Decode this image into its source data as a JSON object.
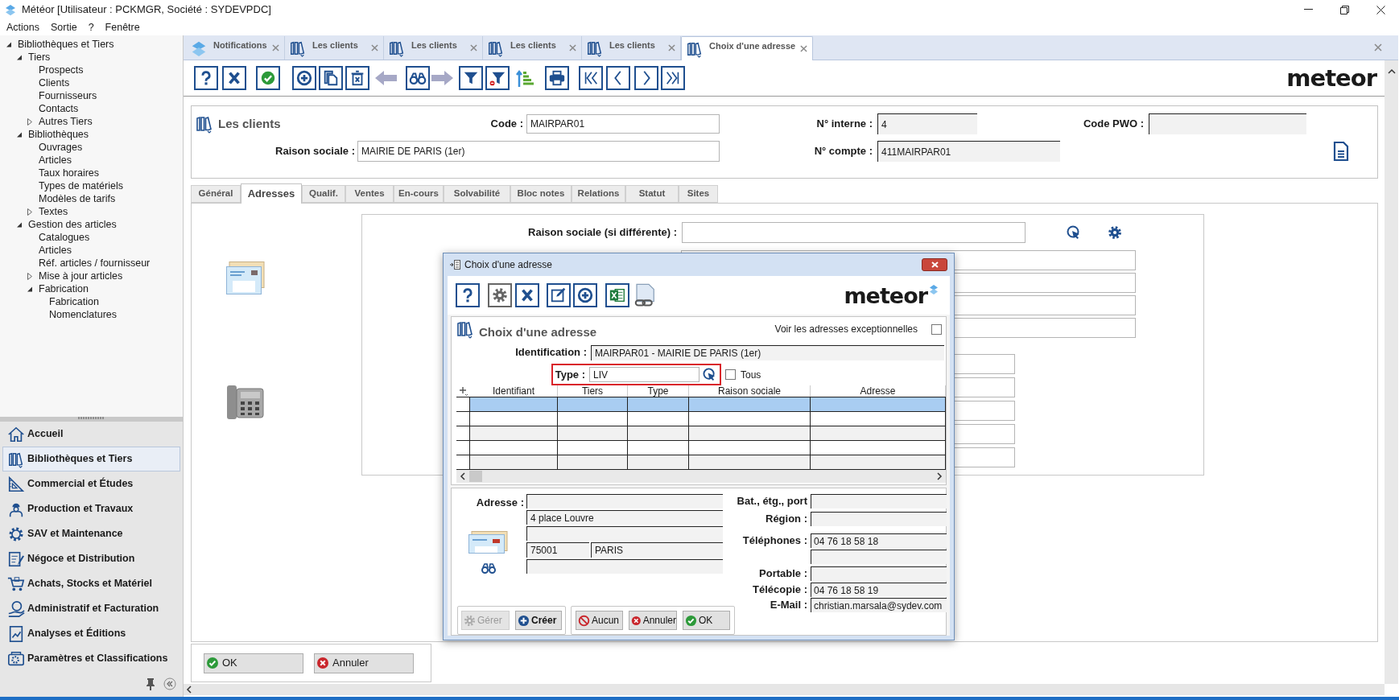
{
  "window": {
    "title": "Météor [Utilisateur : PCKMGR, Société : SYDEVPDC]"
  },
  "menu": [
    {
      "label": "Actions"
    },
    {
      "label": "Sortie"
    },
    {
      "label": "?"
    },
    {
      "label": "Fenêtre"
    }
  ],
  "tree": [
    {
      "label": "Bibliothèques et Tiers",
      "expanded": true,
      "children": [
        {
          "label": "Tiers",
          "expanded": true,
          "children": [
            {
              "label": "Prospects"
            },
            {
              "label": "Clients"
            },
            {
              "label": "Fournisseurs"
            },
            {
              "label": "Contacts"
            },
            {
              "label": "Autres Tiers",
              "expanded": false
            }
          ]
        },
        {
          "label": "Bibliothèques",
          "expanded": true,
          "children": [
            {
              "label": "Ouvrages"
            },
            {
              "label": "Articles"
            },
            {
              "label": "Taux horaires"
            },
            {
              "label": "Types de matériels"
            },
            {
              "label": "Modèles de tarifs"
            },
            {
              "label": "Textes",
              "expanded": false
            }
          ]
        },
        {
          "label": "Gestion des articles",
          "expanded": true,
          "children": [
            {
              "label": "Catalogues"
            },
            {
              "label": "Articles"
            },
            {
              "label": "Réf. articles / fournisseur"
            },
            {
              "label": "Mise à jour articles",
              "expanded": false
            },
            {
              "label": "Fabrication",
              "expanded": true,
              "children": [
                {
                  "label": "Fabrication"
                },
                {
                  "label": "Nomenclatures"
                }
              ]
            }
          ]
        }
      ]
    }
  ],
  "nav": [
    {
      "label": "Accueil",
      "selected": false
    },
    {
      "label": "Bibliothèques et Tiers",
      "selected": true
    },
    {
      "label": "Commercial et Études",
      "selected": false
    },
    {
      "label": "Production et Travaux",
      "selected": false
    },
    {
      "label": "SAV et Maintenance",
      "selected": false
    },
    {
      "label": "Négoce et Distribution",
      "selected": false
    },
    {
      "label": "Achats, Stocks et Matériel",
      "selected": false
    },
    {
      "label": "Administratif et Facturation",
      "selected": false
    },
    {
      "label": "Analyses et Éditions",
      "selected": false
    },
    {
      "label": "Paramètres et Classifications",
      "selected": false
    }
  ],
  "doc_tabs": [
    {
      "label": "Notifications",
      "kind": "notifications",
      "selected": false
    },
    {
      "label": "Les clients",
      "kind": "library",
      "selected": false
    },
    {
      "label": "Les clients",
      "kind": "library",
      "selected": false
    },
    {
      "label": "Les clients",
      "kind": "library",
      "selected": false
    },
    {
      "label": "Les clients",
      "kind": "library",
      "selected": false
    },
    {
      "label": "Choix d'une adresse",
      "kind": "library",
      "selected": true
    }
  ],
  "logo": "meteor",
  "record": {
    "title": "Les clients",
    "code": {
      "label": "Code :",
      "value": "MAIRPAR01"
    },
    "internal_no": {
      "label": "N° interne :",
      "value": "4"
    },
    "code_pwo": {
      "label": "Code PWO :"
    },
    "company_name": {
      "label": "Raison sociale :",
      "value": "MAIRIE DE PARIS (1er)"
    },
    "account_no": {
      "label": "N° compte :",
      "value": "411MAIRPAR01"
    }
  },
  "form_tabs": [
    {
      "label": "Général",
      "selected": false
    },
    {
      "label": "Adresses",
      "selected": true
    },
    {
      "label": "Qualif.",
      "selected": false
    },
    {
      "label": "Ventes",
      "selected": false
    },
    {
      "label": "En-cours",
      "selected": false
    },
    {
      "label": "Solvabilité",
      "selected": false
    },
    {
      "label": "Bloc notes",
      "selected": false
    },
    {
      "label": "Relations",
      "selected": false
    },
    {
      "label": "Statut",
      "selected": false
    },
    {
      "label": "Sites",
      "selected": false
    }
  ],
  "address_form": {
    "company_name_label": "Raison sociale (si différente) :"
  },
  "footer_buttons": [
    {
      "label": "OK",
      "kind": "ok"
    },
    {
      "label": "Annuler",
      "kind": "cancel"
    }
  ],
  "dialog": {
    "title": "Choix d'une adresse",
    "logo": "meteor",
    "heading": "Choix d'une adresse",
    "show_exceptional": {
      "label": "Voir les adresses exceptionnelles",
      "checked": false
    },
    "identification": {
      "label": "Identification :",
      "value": "MAIRPAR01 - MAIRIE DE PARIS (1er)"
    },
    "type": {
      "label": "Type :",
      "value": "LIV"
    },
    "all_types": {
      "label": "Tous",
      "checked": false
    },
    "table": {
      "columns": [
        "Identifiant",
        "Tiers",
        "Type",
        "Raison sociale",
        "Adresse"
      ],
      "rows": [
        {
          "selected": true
        },
        {
          "selected": false
        },
        {
          "selected": false
        },
        {
          "selected": false
        },
        {
          "selected": false
        }
      ]
    },
    "address": {
      "label": "Adresse :",
      "line_2": "4 place Louvre",
      "postal_code": "75001",
      "city": "PARIS"
    },
    "contact_fields": [
      {
        "label": "Bat., étg., port",
        "kind": "single"
      },
      {
        "label": "Région :",
        "kind": "single"
      },
      {
        "label": "Téléphones :",
        "value": "04 76 18 58 18",
        "kind": "double"
      },
      {
        "label": "Portable :",
        "kind": "single"
      },
      {
        "label": "Télécopie :",
        "value": "04 76 18 58 19",
        "kind": "single"
      },
      {
        "label": "E-Mail :",
        "value": "christian.marsala@sydev.com",
        "kind": "single"
      }
    ],
    "buttons": [
      {
        "label": "Gérer",
        "kind": "manage",
        "disabled": true
      },
      {
        "label": "Créer",
        "kind": "create",
        "disabled": false
      },
      {
        "label": "Aucun",
        "kind": "none",
        "disabled": false
      },
      {
        "label": "Annuler",
        "kind": "cancel",
        "disabled": false
      },
      {
        "label": "OK",
        "kind": "ok",
        "disabled": false
      }
    ]
  }
}
